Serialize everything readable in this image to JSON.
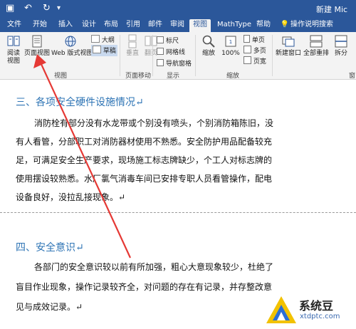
{
  "titlebar": {
    "doc_title": "新建 Mic",
    "undo_glyph": "↶",
    "redo_glyph": "↻",
    "save_glyph": "▣"
  },
  "tabs": [
    {
      "label": "文件"
    },
    {
      "label": "开始"
    },
    {
      "label": "插入"
    },
    {
      "label": "设计"
    },
    {
      "label": "布局"
    },
    {
      "label": "引用"
    },
    {
      "label": "邮件"
    },
    {
      "label": "审阅"
    },
    {
      "label": "视图"
    },
    {
      "label": "MathType"
    },
    {
      "label": "帮助"
    },
    {
      "label": "操作说明搜索"
    }
  ],
  "ribbon": {
    "views": {
      "read_mode": "阅读视图",
      "print_layout": "页面视图",
      "web_layout": "Web 版式视图",
      "outline": "大纲",
      "draft": "草稿",
      "group": "视图"
    },
    "page_movement": {
      "vertical": "垂直",
      "side": "翻页",
      "group": "页面移动"
    },
    "show": {
      "ruler": "标尺",
      "gridlines": "网格线",
      "nav_pane": "导航窗格",
      "group": "显示"
    },
    "zoom": {
      "zoom": "缩放",
      "zoom_100": "100%",
      "one_page": "单页",
      "multiple_pages": "多页",
      "page_width": "页宽",
      "group": "缩放"
    },
    "window": {
      "new_window": "新建窗口",
      "arrange_all": "全部重排",
      "split": "拆分",
      "group": "窗口"
    }
  },
  "document": {
    "heading3": "三、各项安全硬件设施情况↵",
    "para3": [
      "消防栓有部分没有水龙带或个别没有喷头，个别消防箱陈旧，没",
      "有人看管，分部职工对消防器材使用不熟悉。安全防护用品配备较充",
      "足，可满足安全生产要求，现场施工标志牌缺少，个工人对标志牌的",
      "使用摆设较熟悉。水厂氯气消毒车间已安排专职人员看管操作，配电",
      "设备良好，没拉乱接现象。↵"
    ],
    "heading4": "四、安全意识↵",
    "para4": [
      "各部门的安全意识较以前有所加强，粗心大意现象较少，杜绝了",
      "盲目作业现象，操作记录较齐全，对问题的存在有记录，并存整改意",
      "见与成效记录。↵"
    ]
  },
  "watermark": {
    "title": "系统豆",
    "url": "xtdptc.com"
  },
  "colors": {
    "word_blue": "#2b579a",
    "heading_blue": "#2e74b5",
    "arrow_red": "#e53935"
  }
}
